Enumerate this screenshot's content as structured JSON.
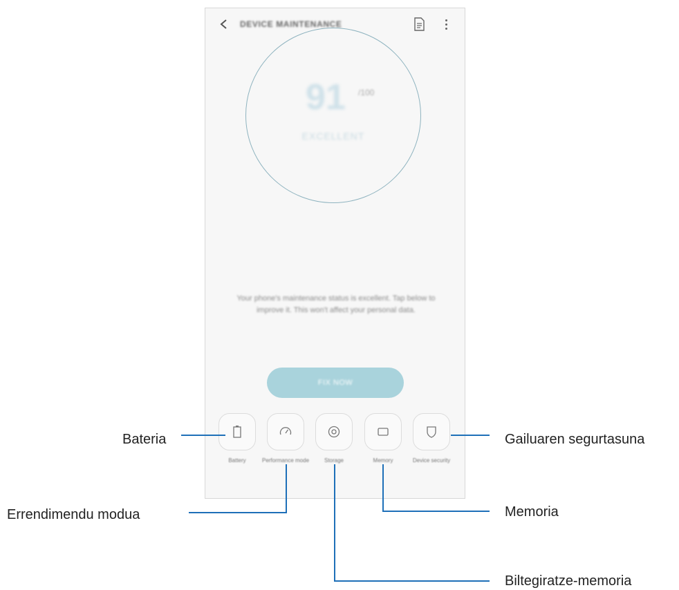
{
  "app": {
    "title": "DEVICE MAINTENANCE",
    "score": "91",
    "score_unit": "/100",
    "score_status": "EXCELLENT",
    "status_text": "Your phone's maintenance status is excellent. Tap below to improve it. This won't affect your personal data.",
    "optimize_button": "FIX NOW",
    "tiles": [
      {
        "label": "Battery",
        "sub": "",
        "icon": "battery-icon"
      },
      {
        "label": "Performance mode",
        "sub": "",
        "icon": "speedometer-icon"
      },
      {
        "label": "Storage",
        "sub": "",
        "icon": "storage-icon"
      },
      {
        "label": "Memory",
        "sub": "",
        "icon": "memory-icon"
      },
      {
        "label": "Device security",
        "sub": "",
        "icon": "shield-icon"
      }
    ]
  },
  "callouts": {
    "bateria": "Bateria",
    "errendimendu": "Errendimendu modua",
    "biltegiratze": "Biltegiratze-memoria",
    "memoria": "Memoria",
    "segurtasuna": "Gailuaren segurtasuna"
  },
  "colors": {
    "callout_line": "#1d6fb8",
    "ring": "#8eb3bf",
    "button": "#a9d3dc"
  }
}
